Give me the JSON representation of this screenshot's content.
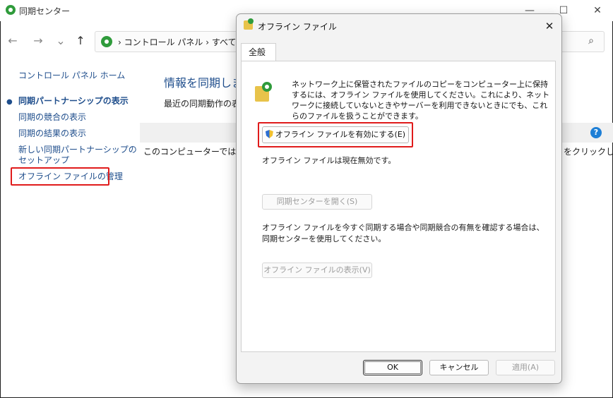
{
  "window": {
    "title": "同期センター",
    "icon": "sync-center-icon",
    "minimize": "—",
    "maximize": "☐",
    "close": "✕"
  },
  "nav": {
    "back": "←",
    "forward": "→",
    "dropdown": "⌄",
    "up": "↑",
    "address": "›  コントロール パネル  ›  すべてのコ",
    "search_icon": "⌕"
  },
  "left_pane": {
    "home": "コントロール パネル ホーム",
    "bullet": "●",
    "items": [
      "同期パートナーシップの表示",
      "同期の競合の表示",
      "同期の結果の表示",
      "新しい同期パートナーシップのセットアップ",
      "オフライン ファイルの管理"
    ]
  },
  "content": {
    "title": "情報を同期しま",
    "description": "最近の同期動作の表",
    "row_text": "このコンピューターでは同期パ",
    "row_text_right": "をクリックしてく",
    "help": "?"
  },
  "dialog": {
    "title": "オフライン ファイル",
    "close": "✕",
    "tab": "全般",
    "intro": "ネットワーク上に保管されたファイルのコピーをコンピューター上に保持するには、オフライン ファイルを使用してください。これにより、ネットワークに接続していないときやサーバーを利用できないときにでも、これらのファイルを扱うことができます。",
    "enable_button": "オフライン ファイルを有効にする(E)",
    "status": "オフライン ファイルは現在無効です。",
    "open_sync_button": "同期センターを開く(S)",
    "sync_note": "オフライン ファイルを今すぐ同期する場合や同期競合の有無を確認する場合は、同期センターを使用してください。",
    "view_files_button": "オフライン ファイルの表示(V)",
    "ok": "OK",
    "cancel": "キャンセル",
    "apply": "適用(A)"
  },
  "colors": {
    "link": "#1f4e8c",
    "highlight": "#e01b1b",
    "sync_green": "#2f9b3b"
  }
}
